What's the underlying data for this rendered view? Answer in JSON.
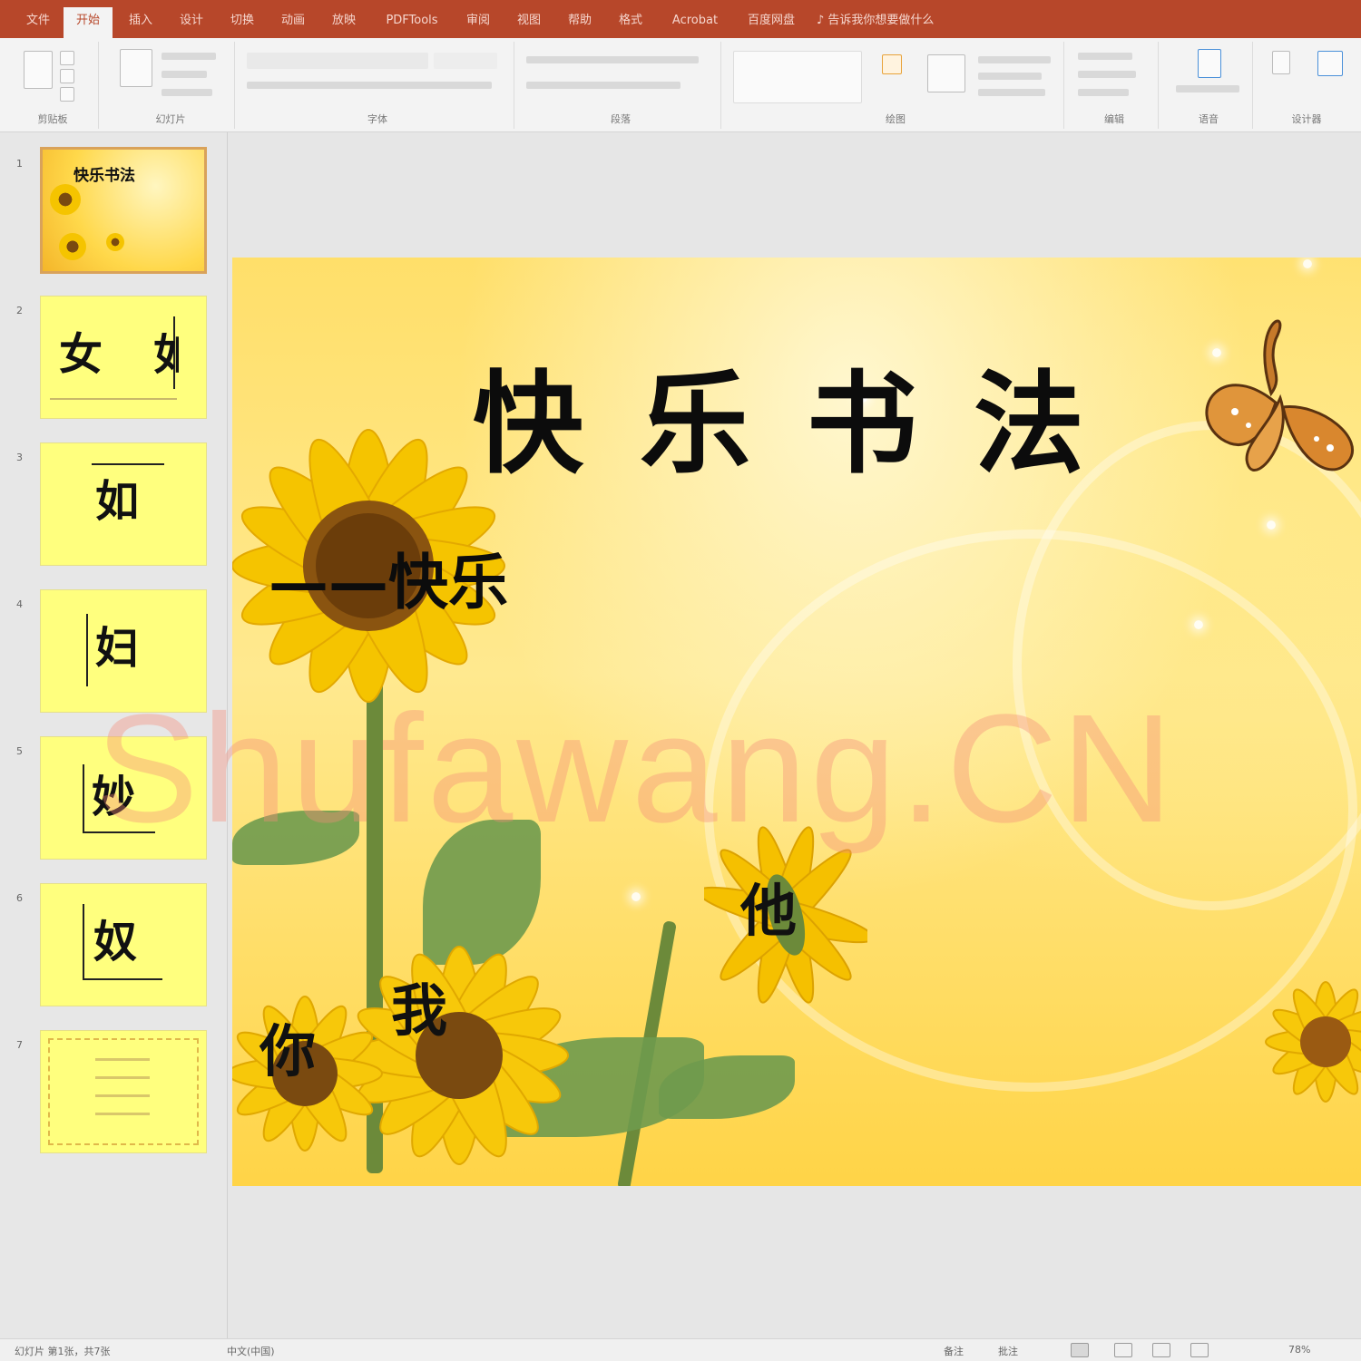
{
  "app": {
    "window_title": "",
    "tabs": [
      "文件",
      "开始",
      "插入",
      "设计",
      "切换",
      "动画",
      "放映",
      "PDFTools",
      "审阅",
      "视图",
      "帮助",
      "格式",
      "Acrobat",
      "百度网盘"
    ],
    "active_tab_index": 1,
    "tell_me": "♪ 告诉我你想要做什么",
    "accent_color": "#b7472a"
  },
  "ribbon": {
    "groups": [
      "剪贴板",
      "幻灯片",
      "字体",
      "段落",
      "绘图",
      "编辑",
      "语音",
      "设计器"
    ]
  },
  "thumbnails": [
    {
      "num": "1",
      "type": "title",
      "title": "快乐书法"
    },
    {
      "num": "2",
      "type": "char",
      "chars": [
        "女",
        "如"
      ]
    },
    {
      "num": "3",
      "type": "char",
      "chars": [
        "如"
      ]
    },
    {
      "num": "4",
      "type": "char",
      "chars": [
        "妇"
      ]
    },
    {
      "num": "5",
      "type": "char",
      "chars": [
        "妙"
      ]
    },
    {
      "num": "6",
      "type": "char",
      "chars": [
        "奴"
      ]
    },
    {
      "num": "7",
      "type": "frame"
    }
  ],
  "slide": {
    "title": "快乐书法",
    "subtitle": "——快乐",
    "flower_chars": {
      "left": "你",
      "middle": "我",
      "right": "他"
    },
    "watermark": "Shufawang.CN",
    "colors": {
      "background": "#ffdf6a",
      "petal": "#f5c400",
      "center": "#7a4a10"
    }
  },
  "status": {
    "slide_info": "幻灯片 第1张，共7张",
    "language": "中文(中国)",
    "notes": "备注",
    "comments": "批注",
    "zoom": "78%"
  }
}
